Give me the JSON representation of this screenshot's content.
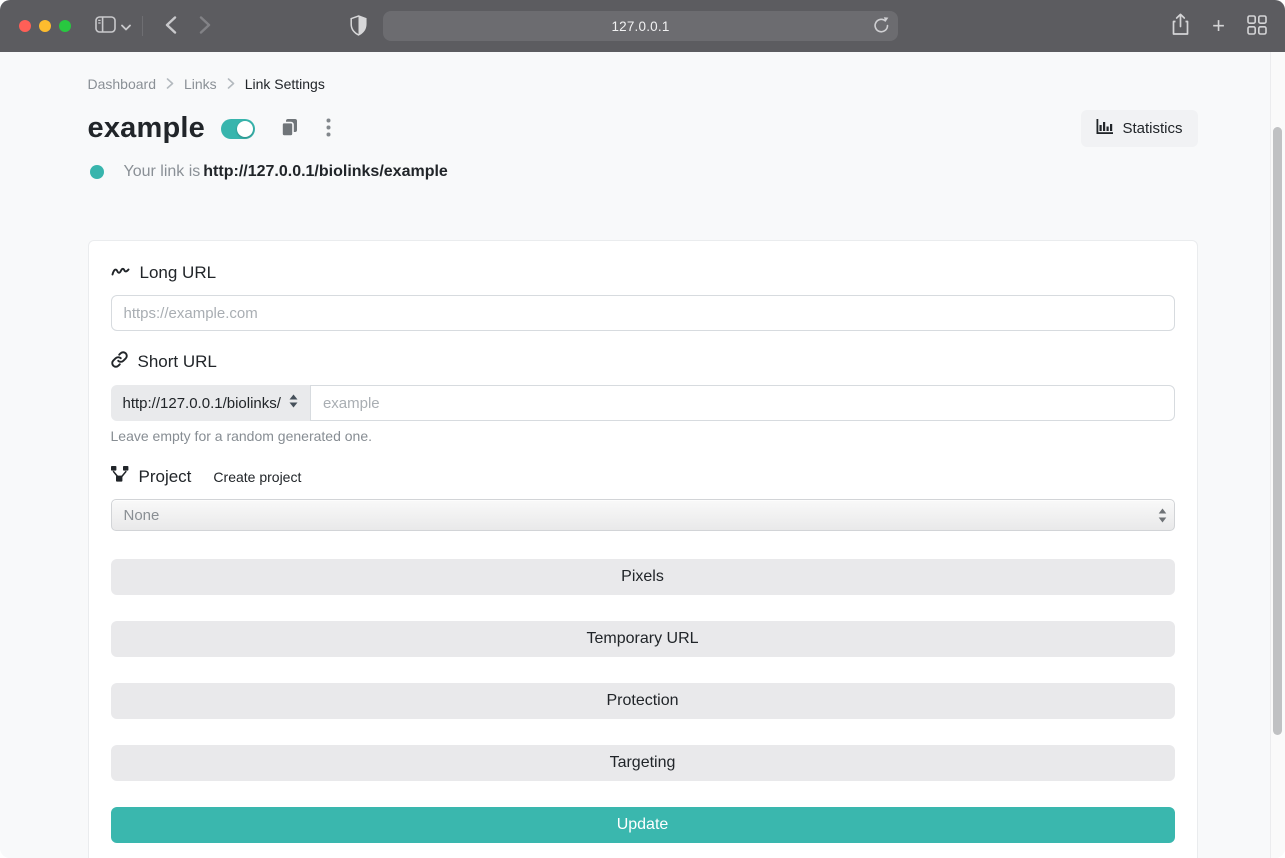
{
  "browser": {
    "url": "127.0.0.1",
    "plus_label": "+"
  },
  "breadcrumb": {
    "items": [
      {
        "label": "Dashboard"
      },
      {
        "label": "Links"
      },
      {
        "label": "Link Settings"
      }
    ]
  },
  "header": {
    "title": "example",
    "toggle_state": "on",
    "statistics_label": "Statistics",
    "status_prefix": "Your link is",
    "status_url": "http://127.0.0.1/biolinks/example"
  },
  "card": {
    "long_url": {
      "label": "Long URL",
      "placeholder": "https://example.com",
      "value": ""
    },
    "short_url": {
      "label": "Short URL",
      "domain_select_value": "http://127.0.0.1/biolinks/",
      "placeholder": "example",
      "value": "",
      "helper": "Leave empty for a random generated one."
    },
    "project": {
      "label": "Project",
      "create_label": "Create project",
      "select_value": "None"
    },
    "sections": [
      "Pixels",
      "Temporary URL",
      "Protection",
      "Targeting"
    ],
    "update_label": "Update"
  },
  "colors": {
    "accent_teal": "#38b5ad",
    "chrome_gray": "#5c5c60",
    "button_gray": "#e9e9eb",
    "page_bg": "#f8f9fa"
  },
  "icons": [
    "sidebar-icon",
    "chevron-down-icon",
    "back-icon",
    "forward-icon",
    "shield-icon",
    "reload-icon",
    "share-icon",
    "plus-icon",
    "tabs-grid-icon",
    "squiggle-icon",
    "link-icon",
    "project-diagram-icon",
    "bar-chart-icon",
    "copy-icon",
    "kebab-icon",
    "select-arrows-icon",
    "circle-dot-icon"
  ]
}
